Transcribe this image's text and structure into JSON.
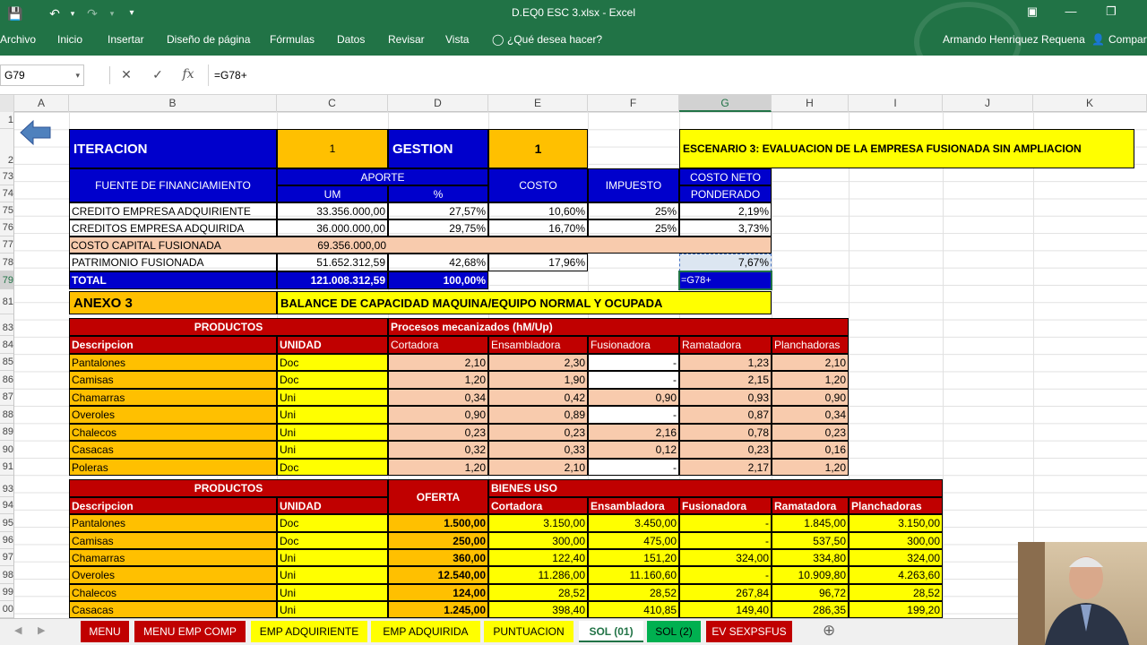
{
  "window": {
    "title": "D.EQ0 ESC 3.xlsx - Excel",
    "user": "Armando Henriquez Requena",
    "share": "Compart"
  },
  "ribbon": {
    "tabs": [
      "Archivo",
      "Inicio",
      "Insertar",
      "Diseño de página",
      "Fórmulas",
      "Datos",
      "Revisar",
      "Vista"
    ],
    "tell_me": "¿Qué desea hacer?"
  },
  "formula_bar": {
    "name_box": "G79",
    "formula": "=G78+"
  },
  "columns": [
    "A",
    "B",
    "C",
    "D",
    "E",
    "F",
    "G",
    "H",
    "I",
    "J",
    "K"
  ],
  "rows": [
    "1",
    "2",
    "73",
    "74",
    "75",
    "76",
    "77",
    "78",
    "79",
    "81",
    "83",
    "84",
    "85",
    "86",
    "87",
    "88",
    "89",
    "90",
    "91",
    "93",
    "94",
    "95",
    "96",
    "97",
    "98",
    "99",
    "00"
  ],
  "header": {
    "iteracion_label": "ITERACION",
    "iteracion_value": "1",
    "gestion_label": "GESTION",
    "gestion_value": "1",
    "escenario": "ESCENARIO 3: EVALUACION DE LA EMPRESA FUSIONADA SIN AMPLIACION"
  },
  "finance": {
    "h_fuente": "FUENTE DE FINANCIAMIENTO",
    "h_aporte": "APORTE",
    "h_um": "UM",
    "h_pct": "%",
    "h_costo": "COSTO",
    "h_impuesto": "IMPUESTO",
    "h_costo_neto_1": "COSTO NETO",
    "h_costo_neto_2": "PONDERADO",
    "rows": [
      {
        "label": "CREDITO EMPRESA ADQUIRIENTE",
        "um": "33.356.000,00",
        "pct": "27,57%",
        "costo": "10,60%",
        "impuesto": "25%",
        "neto": "2,19%"
      },
      {
        "label": "CREDITOS EMPRESA ADQUIRIDA",
        "um": "36.000.000,00",
        "pct": "29,75%",
        "costo": "16,70%",
        "impuesto": "25%",
        "neto": "3,73%"
      }
    ],
    "costo_capital_label": "COSTO CAPITAL FUSIONADA",
    "costo_capital_um": "69.356.000,00",
    "patrimonio_label": "PATRIMONIO FUSIONADA",
    "patrimonio_um": "51.652.312,59",
    "patrimonio_pct": "42,68%",
    "patrimonio_costo": "17,96%",
    "patrimonio_neto": "7,67%",
    "total_label": "TOTAL",
    "total_um": "121.008.312,59",
    "total_pct": "100,00%",
    "editing": "=G78+"
  },
  "anexo": {
    "label": "ANEXO 3",
    "title": "BALANCE DE CAPACIDAD MAQUINA/EQUIPO NORMAL Y OCUPADA"
  },
  "table1": {
    "h_productos": "PRODUCTOS",
    "h_procesos": "Procesos mecanizados (hM/Up)",
    "h_desc": "Descripcion",
    "h_unidad": "UNIDAD",
    "procesos": [
      "Cortadora",
      "Ensambladora",
      "Fusionadora",
      "Ramatadora",
      "Planchadoras"
    ],
    "rows": [
      {
        "desc": "Pantalones",
        "unidad": "Doc",
        "v": [
          "2,10",
          "2,30",
          "-",
          "1,23",
          "2,10"
        ]
      },
      {
        "desc": "Camisas",
        "unidad": "Doc",
        "v": [
          "1,20",
          "1,90",
          "-",
          "2,15",
          "1,20"
        ]
      },
      {
        "desc": "Chamarras",
        "unidad": "Uni",
        "v": [
          "0,34",
          "0,42",
          "0,90",
          "0,93",
          "0,90"
        ]
      },
      {
        "desc": "Overoles",
        "unidad": "Uni",
        "v": [
          "0,90",
          "0,89",
          "-",
          "0,87",
          "0,34"
        ]
      },
      {
        "desc": "Chalecos",
        "unidad": "Uni",
        "v": [
          "0,23",
          "0,23",
          "2,16",
          "0,78",
          "0,23"
        ]
      },
      {
        "desc": "Casacas",
        "unidad": "Uni",
        "v": [
          "0,32",
          "0,33",
          "0,12",
          "0,23",
          "0,16"
        ]
      },
      {
        "desc": "Poleras",
        "unidad": "Doc",
        "v": [
          "1,20",
          "2,10",
          "-",
          "2,17",
          "1,20"
        ]
      }
    ]
  },
  "table2": {
    "h_productos": "PRODUCTOS",
    "h_oferta": "OFERTA",
    "h_bienes": "BIENES USO",
    "h_desc": "Descripcion",
    "h_unidad": "UNIDAD",
    "procesos": [
      "Cortadora",
      "Ensambladora",
      "Fusionadora",
      "Ramatadora",
      "Planchadoras"
    ],
    "rows": [
      {
        "desc": "Pantalones",
        "unidad": "Doc",
        "oferta": "1.500,00",
        "v": [
          "3.150,00",
          "3.450,00",
          "-",
          "1.845,00",
          "3.150,00"
        ]
      },
      {
        "desc": "Camisas",
        "unidad": "Doc",
        "oferta": "250,00",
        "v": [
          "300,00",
          "475,00",
          "-",
          "537,50",
          "300,00"
        ]
      },
      {
        "desc": "Chamarras",
        "unidad": "Uni",
        "oferta": "360,00",
        "v": [
          "122,40",
          "151,20",
          "324,00",
          "334,80",
          "324,00"
        ]
      },
      {
        "desc": "Overoles",
        "unidad": "Uni",
        "oferta": "12.540,00",
        "v": [
          "11.286,00",
          "11.160,60",
          "-",
          "10.909,80",
          "4.263,60"
        ]
      },
      {
        "desc": "Chalecos",
        "unidad": "Uni",
        "oferta": "124,00",
        "v": [
          "28,52",
          "28,52",
          "267,84",
          "96,72",
          "28,52"
        ]
      },
      {
        "desc": "Casacas",
        "unidad": "Uni",
        "oferta": "1.245,00",
        "v": [
          "398,40",
          "410,85",
          "149,40",
          "286,35",
          "199,20"
        ]
      }
    ]
  },
  "sheets": [
    "MENU",
    "MENU EMP COMP",
    "EMP ADQUIRIENTE",
    "EMP ADQUIRIDA",
    "PUNTUACION",
    "SOL (01)",
    "SOL (2)",
    "EV SEXPSFUS"
  ],
  "colors": {
    "excel_green": "#217346",
    "blue": "#0000cc",
    "orange": "#ffc000",
    "yellow": "#ffff00",
    "red": "#c00000",
    "peach": "#f8cbad"
  }
}
